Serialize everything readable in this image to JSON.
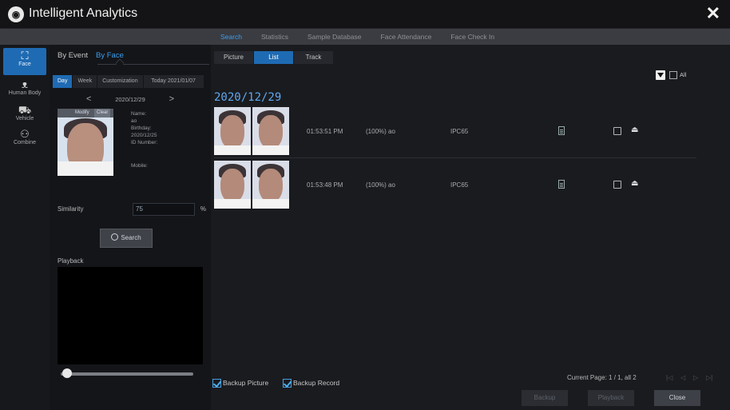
{
  "app": {
    "title": "Intelligent Analytics",
    "logo_icon": "camera-lens-icon",
    "close_glyph": "✕"
  },
  "top_tabs": [
    {
      "label": "Search",
      "active": true
    },
    {
      "label": "Statistics",
      "active": false
    },
    {
      "label": "Sample Database",
      "active": false
    },
    {
      "label": "Face Attendance",
      "active": false
    },
    {
      "label": "Face Check In",
      "active": false
    }
  ],
  "left_nav": [
    {
      "label": "Face",
      "icon": "face-frame-icon",
      "active": true
    },
    {
      "label": "Human Body",
      "icon": "human-body-icon",
      "active": false
    },
    {
      "label": "Vehicle",
      "icon": "vehicle-icon",
      "active": false
    },
    {
      "label": "Combine",
      "icon": "combine-icon",
      "active": false
    }
  ],
  "sub_tabs": {
    "by_event": "By Event",
    "by_face": "By Face"
  },
  "date_tabs": {
    "day": "Day",
    "week": "Week",
    "customization": "Customization",
    "today": "Today 2021/01/07"
  },
  "date_nav": {
    "prev": "<",
    "current": "2020/12/29",
    "next": ">"
  },
  "face_card": {
    "modify": "Modify",
    "clear": "Clear"
  },
  "face_info": {
    "name_label": "Name:",
    "name_value": "ao",
    "birthday_label": "Birthday:",
    "birthday_value": "2020/12/25",
    "id_label": "ID Number:",
    "mobile_label": "Mobile:"
  },
  "similarity": {
    "label": "Similarity",
    "value": "75",
    "unit": "%"
  },
  "search_button": "Search",
  "playback_label": "Playback",
  "slider": {
    "position": 0.05
  },
  "view_tabs": [
    {
      "label": "Picture",
      "active": false
    },
    {
      "label": "List",
      "active": true
    },
    {
      "label": "Track",
      "active": false
    }
  ],
  "all_label": "All",
  "result_date": "2020/12/29",
  "results": [
    {
      "time": "01:53:51 PM",
      "match": "(100%) ao",
      "camera": "IPC65"
    },
    {
      "time": "01:53:48 PM",
      "match": "(100%) ao",
      "camera": "IPC65"
    }
  ],
  "bottom": {
    "backup_picture": "Backup Picture",
    "backup_record": "Backup Record",
    "page_info": "Current Page: 1 / 1, all 2",
    "first": "|◁",
    "prev": "◁",
    "next": "▷",
    "last": "▷|",
    "backup_button": "Backup",
    "playback_button": "Playback",
    "close_button": "Close"
  }
}
